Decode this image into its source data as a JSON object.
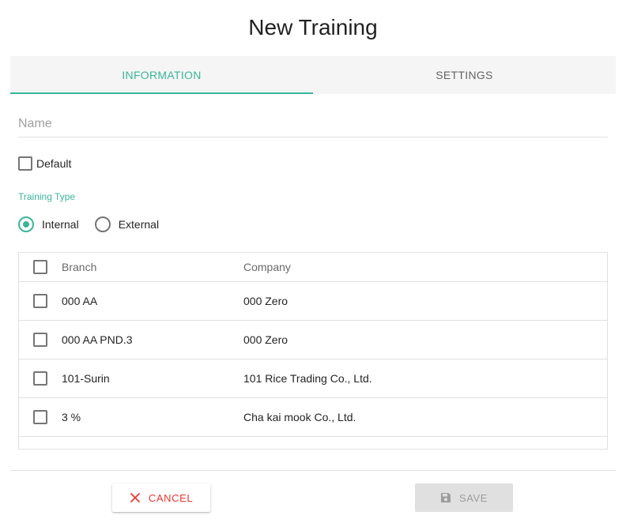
{
  "dialog": {
    "title": "New Training"
  },
  "tabs": [
    {
      "label": "INFORMATION",
      "active": true
    },
    {
      "label": "SETTINGS",
      "active": false
    }
  ],
  "form": {
    "name_placeholder": "Name",
    "name_value": "",
    "default_label": "Default",
    "default_checked": false,
    "training_type_label": "Training Type",
    "training_type_options": [
      {
        "label": "Internal",
        "checked": true
      },
      {
        "label": "External",
        "checked": false
      }
    ]
  },
  "table": {
    "columns": [
      "Branch",
      "Company"
    ],
    "rows": [
      {
        "branch": "000 AA",
        "company": "000 Zero"
      },
      {
        "branch": "000 AA PND.3",
        "company": "000 Zero"
      },
      {
        "branch": "101-Surin",
        "company": "101 Rice Trading Co., Ltd."
      },
      {
        "branch": "3 %",
        "company": "Cha kai mook Co., Ltd."
      }
    ]
  },
  "actions": {
    "cancel_label": "CANCEL",
    "cancel_icon": "close-icon",
    "save_label": "SAVE",
    "save_icon": "save-icon",
    "save_disabled": true
  },
  "colors": {
    "accent": "#3cb59a",
    "cancel": "#e53935",
    "tab_bar_bg": "#f5f5f5"
  }
}
